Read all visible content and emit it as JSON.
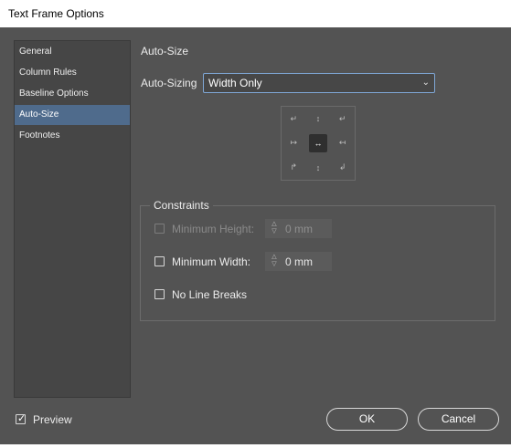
{
  "window": {
    "title": "Text Frame Options"
  },
  "sidebar": {
    "items": [
      {
        "label": "General"
      },
      {
        "label": "Column Rules"
      },
      {
        "label": "Baseline Options"
      },
      {
        "label": "Auto-Size",
        "active": true
      },
      {
        "label": "Footnotes"
      }
    ]
  },
  "section": {
    "title": "Auto-Size"
  },
  "auto_sizing": {
    "label": "Auto-Sizing",
    "value": "Width Only"
  },
  "reference_point": {
    "selected": "center"
  },
  "constraints": {
    "title": "Constraints",
    "min_height": {
      "label": "Minimum Height:",
      "value": "0 mm",
      "checked": false,
      "disabled": true
    },
    "min_width": {
      "label": "Minimum Width:",
      "value": "0 mm",
      "checked": false,
      "disabled": false
    },
    "no_line_breaks": {
      "label": "No Line Breaks",
      "checked": false
    }
  },
  "footer": {
    "preview_label": "Preview",
    "preview_checked": true,
    "ok_label": "OK",
    "cancel_label": "Cancel"
  }
}
